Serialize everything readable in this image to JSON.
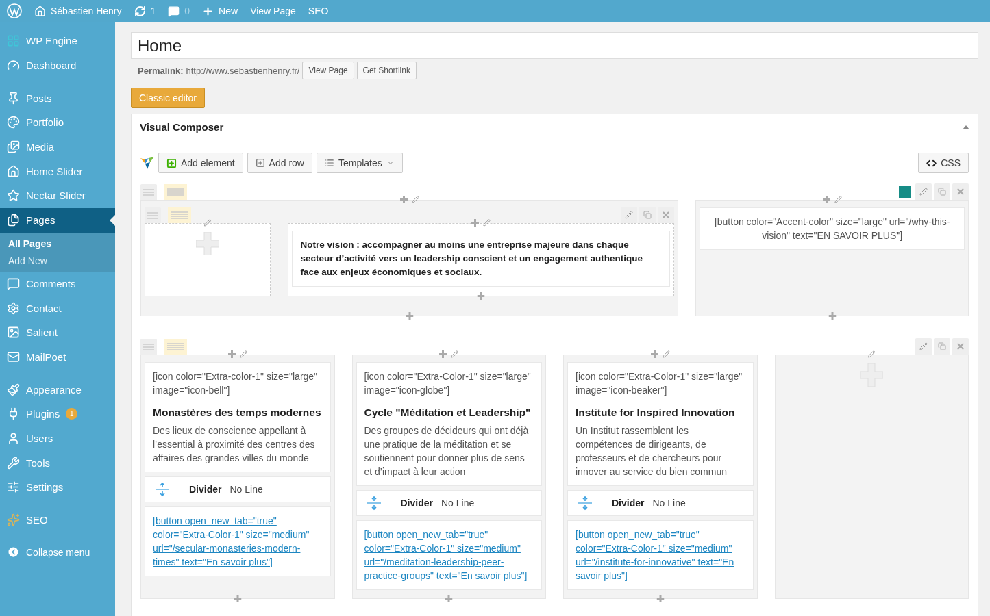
{
  "admin_bar": {
    "items": [
      {
        "kind": "logo"
      },
      {
        "kind": "site",
        "label": "Sébastien Henry"
      },
      {
        "kind": "updates",
        "label": "1"
      },
      {
        "kind": "comments",
        "label": "0"
      },
      {
        "kind": "new",
        "label": "New"
      },
      {
        "kind": "link",
        "label": "View Page"
      },
      {
        "kind": "link",
        "label": "SEO"
      }
    ]
  },
  "sidebar": {
    "groups": [
      [
        {
          "label": "WP Engine",
          "selected": false
        },
        {
          "label": "Dashboard",
          "selected": false
        }
      ],
      [
        {
          "label": "Posts",
          "selected": false
        },
        {
          "label": "Portfolio",
          "selected": false
        },
        {
          "label": "Media",
          "selected": false
        },
        {
          "label": "Home Slider",
          "selected": false
        },
        {
          "label": "Nectar Slider",
          "selected": false
        },
        {
          "label": "Pages",
          "selected": true,
          "children": [
            {
              "label": "All Pages",
              "selected": true
            },
            {
              "label": "Add New",
              "selected": false
            }
          ]
        },
        {
          "label": "Comments",
          "selected": false
        },
        {
          "label": "Contact",
          "selected": false
        },
        {
          "label": "Salient",
          "selected": false
        },
        {
          "label": "MailPoet",
          "selected": false
        }
      ],
      [
        {
          "label": "Appearance",
          "selected": false
        },
        {
          "label": "Plugins",
          "selected": false,
          "badge": "1"
        },
        {
          "label": "Users",
          "selected": false
        },
        {
          "label": "Tools",
          "selected": false
        },
        {
          "label": "Settings",
          "selected": false
        }
      ],
      [
        {
          "label": "SEO",
          "selected": false
        }
      ]
    ],
    "collapse": "Collapse menu"
  },
  "editor": {
    "title": "Home",
    "permalink_label": "Permalink:",
    "permalink_url": "http://www.sebastienhenry.fr/",
    "permalink_buttons": [
      "View Page",
      "Get Shortlink"
    ],
    "classic_editor_button": "Classic editor"
  },
  "composer": {
    "title": "Visual Composer",
    "expanded": true,
    "toolbar": {
      "buttons": [
        {
          "kind": "add_element",
          "label": "Add element"
        },
        {
          "kind": "add_row",
          "label": "Add row"
        },
        {
          "kind": "templates",
          "label": "Templates"
        }
      ],
      "css_button": "CSS"
    },
    "rows": [
      {
        "color": "#168c86",
        "columns": [
          {
            "kind": "inner_row",
            "columns": [
              {
                "kind": "empty"
              },
              {
                "kind": "elements",
                "elements": [
                  {
                    "kind": "text",
                    "paragraphs": [
                      {
                        "kind": "lead",
                        "text": "Notre vision : accompagner au moins une entreprise majeure dans chaque secteur d’activité vers un leadership conscient et un engagement authentique face aux enjeux économiques et sociaux."
                      }
                    ]
                  }
                ]
              }
            ]
          },
          {
            "kind": "elements",
            "elements": [
              {
                "kind": "text",
                "paragraphs": [
                  {
                    "kind": "centered",
                    "text": "[button color=\"Accent-color\" size=\"large\" url=\"/why-this-vision\" text=\"EN SAVOIR PLUS\"]"
                  }
                ]
              }
            ]
          }
        ]
      },
      {
        "columns": [
          {
            "kind": "elements",
            "elements": [
              {
                "kind": "text",
                "paragraphs": [
                  {
                    "kind": "shortcode",
                    "text": "[icon color=\"Extra-color-1\" size=\"large\" image=\"icon-bell\"]"
                  },
                  {
                    "kind": "heading",
                    "text": "Monastères des temps modernes"
                  },
                  {
                    "kind": "body",
                    "text": "Des lieux de conscience appellant à l’essential à proximité des centres des affaires des grandes villes du monde"
                  }
                ]
              },
              {
                "kind": "divider",
                "label": "Divider",
                "value": "No Line"
              },
              {
                "kind": "link",
                "text": "[button open_new_tab=\"true\" color=\"Extra-Color-1\" size=\"medium\" url=\"/secular-monasteries-modern-times\" text=\"En savoir plus\"]"
              }
            ]
          },
          {
            "kind": "elements",
            "elements": [
              {
                "kind": "text",
                "paragraphs": [
                  {
                    "kind": "shortcode",
                    "text": "[icon color=\"Extra-Color-1\" size=\"large\" image=\"icon-globe\"]"
                  },
                  {
                    "kind": "heading",
                    "text": "Cycle \"Méditation et Leadership\""
                  },
                  {
                    "kind": "body",
                    "text": "Des groupes de décideurs qui ont déjà une pratique de la méditation et se soutiennent pour donner plus de sens et d’impact à leur action"
                  }
                ]
              },
              {
                "kind": "divider",
                "label": "Divider",
                "value": "No Line"
              },
              {
                "kind": "link",
                "text": "[button open_new_tab=\"true\" color=\"Extra-Color-1\" size=\"medium\" url=\"/meditation-leadership-peer-practice-groups\" text=\"En savoir plus\"]"
              }
            ]
          },
          {
            "kind": "elements",
            "elements": [
              {
                "kind": "text",
                "paragraphs": [
                  {
                    "kind": "shortcode",
                    "text": "[icon color=\"Extra-Color-1\" size=\"large\" image=\"icon-beaker\"]"
                  },
                  {
                    "kind": "heading",
                    "text": "Institute for Inspired Innovation"
                  },
                  {
                    "kind": "body",
                    "text": "Un Institut rassemblent les compétences de dirigeants, de professeurs et de chercheurs pour innover au service du bien commun"
                  }
                ]
              },
              {
                "kind": "divider",
                "label": "Divider",
                "value": "No Line"
              },
              {
                "kind": "link",
                "text": "[button open_new_tab=\"true\" color=\"Extra-Color-1\" size=\"medium\" url=\"/institute-for-innovative\" text=\"En savoir plus\"]"
              }
            ]
          },
          {
            "kind": "empty"
          }
        ]
      }
    ]
  }
}
